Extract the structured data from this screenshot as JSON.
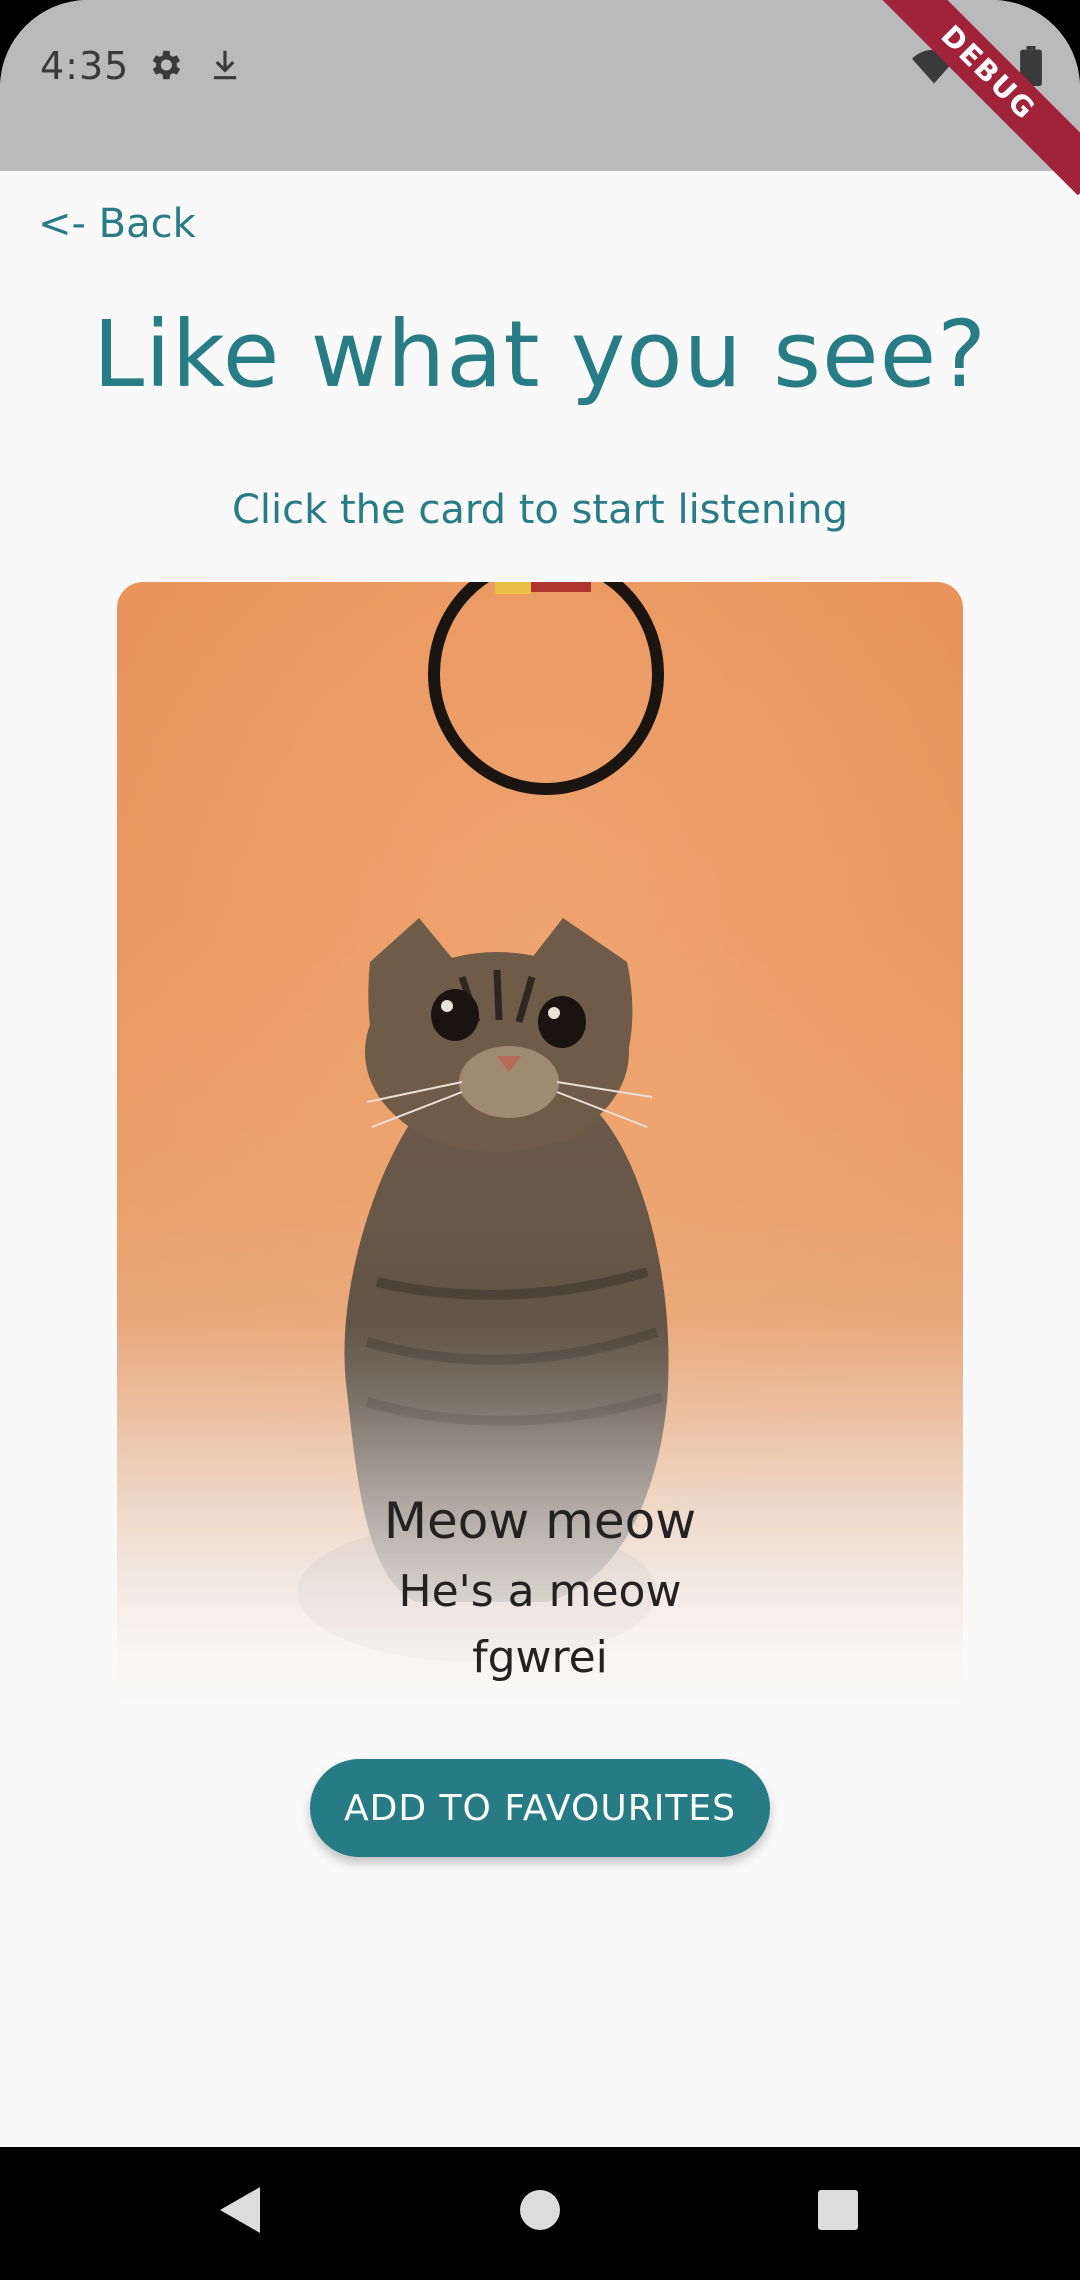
{
  "status_bar": {
    "time": "4:35",
    "left_icons": [
      "gear-icon",
      "download-icon"
    ],
    "right_icons": [
      "wifi-icon",
      "signal-icon",
      "battery-icon"
    ],
    "debug_label": "DEBUG"
  },
  "header": {
    "back_label": "<- Back",
    "title": "Like what you see?",
    "subtitle": "Click the card to start listening"
  },
  "card": {
    "image": "cat-photo",
    "title": "Meow meow",
    "description": "He's a meow",
    "extra": "fgwrei"
  },
  "actions": {
    "favourite_label": "ADD TO FAVOURITES"
  },
  "nav_bar": {
    "buttons": [
      "back-triangle-icon",
      "home-circle-icon",
      "recents-square-icon"
    ]
  },
  "colors": {
    "accent": "#277c85",
    "button": "#267b84",
    "status_bar": "#bababa",
    "background": "#f9f9f9"
  }
}
